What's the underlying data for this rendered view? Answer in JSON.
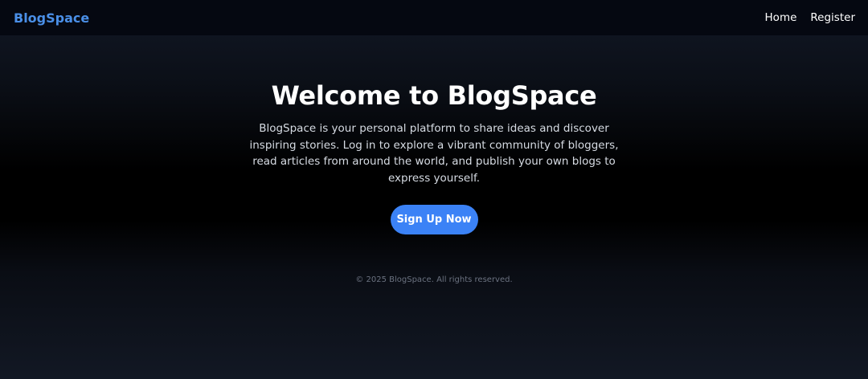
{
  "nav": {
    "brand": "BlogSpace",
    "links": [
      {
        "label": "Home"
      },
      {
        "label": "Register"
      }
    ]
  },
  "hero": {
    "title": "Welcome to BlogSpace",
    "description": "BlogSpace is your personal platform to share ideas and discover inspiring stories. Log in to explore a vibrant community of bloggers, read articles from around the world, and publish your own blogs to express yourself.",
    "cta_label": "Sign Up Now"
  },
  "footer": {
    "text": "© 2025 BlogSpace. All rights reserved."
  },
  "colors": {
    "brand": "#4a8fe7",
    "cta": "#3b82f6",
    "navbar_bg": "#050811",
    "footer_text": "#6b7280"
  }
}
